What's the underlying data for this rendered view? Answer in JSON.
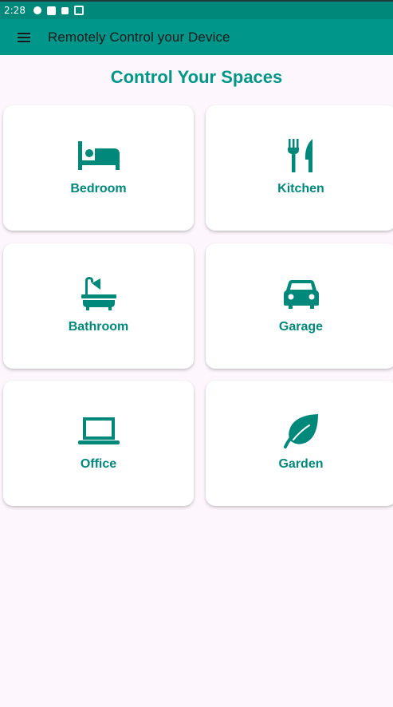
{
  "status_bar": {
    "time": "2:28",
    "icons": [
      "data-saver-icon",
      "notification-square-icon",
      "accessibility-icon",
      "screen-share-icon"
    ]
  },
  "app_bar": {
    "menu_icon": "menu-icon",
    "title": "Remotely Control your Device",
    "color": "#00968a"
  },
  "main": {
    "heading": "Control Your Spaces",
    "accent_color": "#009688",
    "rooms": [
      {
        "label": "Bedroom",
        "icon": "bed-icon"
      },
      {
        "label": "Kitchen",
        "icon": "fork-knife-icon"
      },
      {
        "label": "Bathroom",
        "icon": "bathtub-icon"
      },
      {
        "label": "Garage",
        "icon": "car-icon"
      },
      {
        "label": "Office",
        "icon": "laptop-icon"
      },
      {
        "label": "Garden",
        "icon": "leaf-icon"
      }
    ]
  }
}
